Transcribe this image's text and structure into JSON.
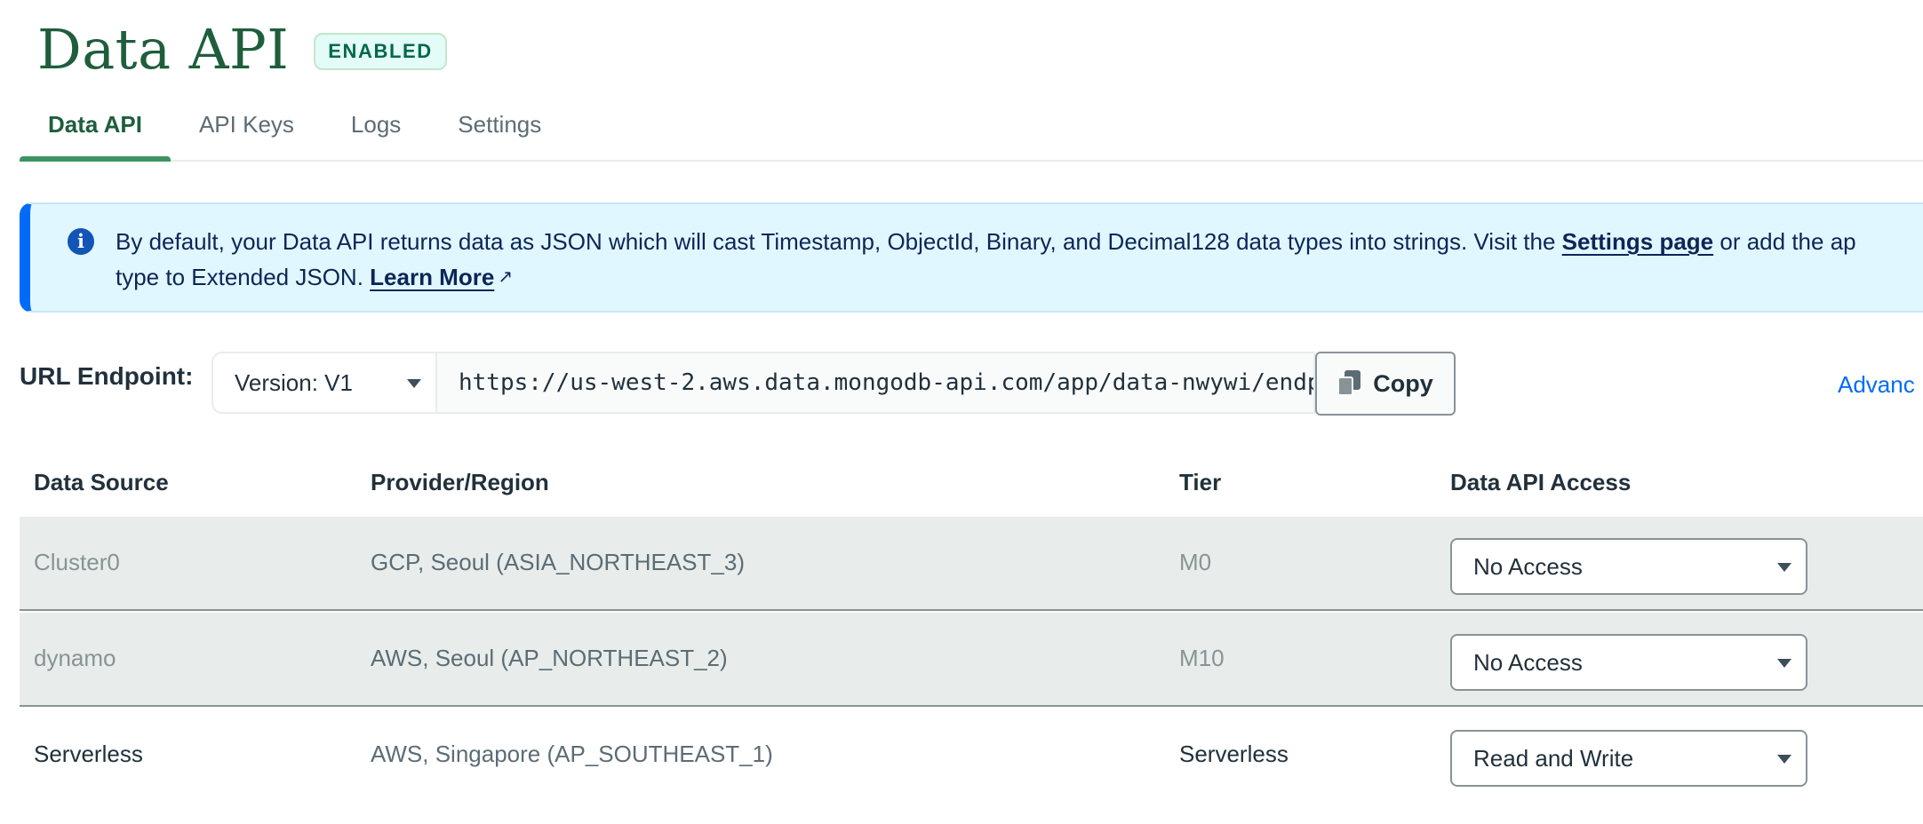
{
  "header": {
    "title": "Data API",
    "status_badge": "ENABLED"
  },
  "tabs": [
    {
      "label": "Data API",
      "active": true
    },
    {
      "label": "API Keys",
      "active": false
    },
    {
      "label": "Logs",
      "active": false
    },
    {
      "label": "Settings",
      "active": false
    }
  ],
  "banner": {
    "text_before_settings": "By default, your Data API returns data as JSON which will cast Timestamp, ObjectId, Binary, and Decimal128 data types into strings. Visit the ",
    "settings_link": "Settings page",
    "text_after_settings": " or add the ap",
    "text_line2": "type to Extended JSON. ",
    "learn_more_link": "Learn More",
    "icon": "info-icon",
    "accent_color": "#016bf8"
  },
  "endpoint": {
    "label": "URL Endpoint:",
    "version_value": "Version: V1",
    "url": "https://us-west-2.aws.data.mongodb-api.com/app/data-nwywi/endp",
    "copy_label": "Copy",
    "advanced_link": "Advanc"
  },
  "table": {
    "headers": {
      "source": "Data Source",
      "region": "Provider/Region",
      "tier": "Tier",
      "access": "Data API Access"
    },
    "rows": [
      {
        "source": "Cluster0",
        "region": "GCP, Seoul (ASIA_NORTHEAST_3)",
        "tier": "M0",
        "access": "No Access"
      },
      {
        "source": "dynamo",
        "region": "AWS, Seoul (AP_NORTHEAST_2)",
        "tier": "M10",
        "access": "No Access"
      },
      {
        "source": "Serverless",
        "region": "AWS, Singapore (AP_SOUTHEAST_1)",
        "tier": "Serverless",
        "access": "Read and Write"
      }
    ]
  },
  "colors": {
    "brand_green": "#1e5e3c",
    "tab_underline": "#3d9462",
    "link_blue": "#016bf8"
  }
}
